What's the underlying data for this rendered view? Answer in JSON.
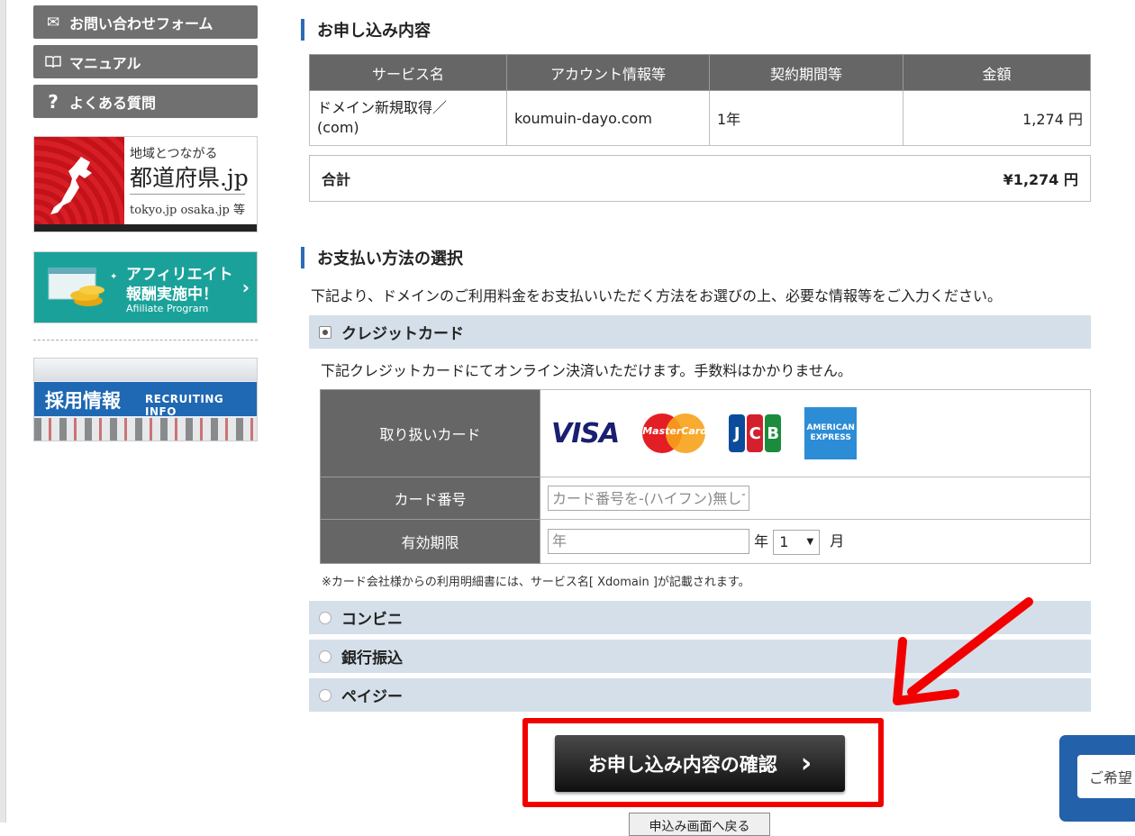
{
  "sidebar": {
    "contact_label": "お問い合わせフォーム",
    "manual_label": "マニュアル",
    "faq_label": "よくある質問",
    "banner_pref": {
      "line1": "地域とつながる",
      "line2": "都道府県.jp",
      "line3": "tokyo.jp osaka.jp 等"
    },
    "banner_affiliate": {
      "line1": "アフィリエイト",
      "line2": "報酬実施中！",
      "line3": "Afiiliate Program"
    },
    "banner_recruit": {
      "title": "採用情報",
      "subtitle": "RECRUITING INFO"
    }
  },
  "order": {
    "heading": "お申し込み内容",
    "headers": [
      "サービス名",
      "アカウント情報等",
      "契約期間等",
      "金額"
    ],
    "row": {
      "service": "ドメイン新規取得／(com)",
      "account": "koumuin-dayo.com",
      "period": "1年",
      "price": "1,274 円"
    },
    "total_label": "合計",
    "total_value": "¥1,274 円"
  },
  "payment": {
    "heading": "お支払い方法の選択",
    "lead": "下記より、ドメインのご利用料金をお支払いいただく方法をお選びの上、必要な情報等をご入力ください。",
    "credit_label": "クレジットカード",
    "credit_desc": "下記クレジットカードにてオンライン決済いただけます。手数料はかかりません。",
    "cards_label": "取り扱いカード",
    "card_logos": {
      "visa": "VISA",
      "mastercard": "MasterCard",
      "jcb": "JCB",
      "amex": "AMERICAN EXPRESS"
    },
    "card_number_label": "カード番号",
    "card_number_placeholder": "カード番号を-(ハイフン)無しで入力",
    "expiry_label": "有効期限",
    "year_placeholder": "年",
    "year_unit": "年",
    "month_value": "1",
    "month_unit": "月",
    "note": "※カード会社様からの利用明細書には、サービス名[ Xdomain ]が記載されます。",
    "convenience_label": "コンビニ",
    "bank_label": "銀行振込",
    "payeasy_label": "ペイジー"
  },
  "actions": {
    "confirm_label": "お申し込み内容の確認",
    "confirm_chevron": "›",
    "back_label": "申込み画面へ戻る"
  },
  "chat": {
    "text": "ご希望"
  },
  "colors": {
    "highlight_red": "#f20000",
    "header_gray": "#666666",
    "option_blue": "#d4dfe9",
    "accent_blue": "#2c6bb7"
  }
}
